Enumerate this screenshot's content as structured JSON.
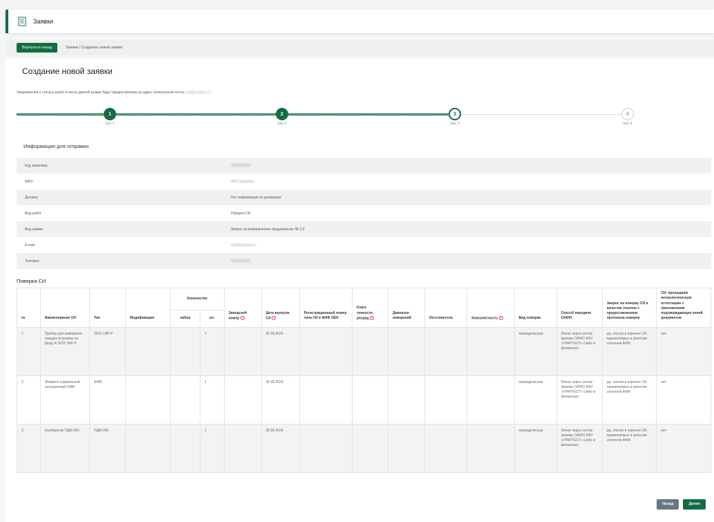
{
  "header": {
    "title": "Заявки",
    "icon": "document-icon",
    "accent": "#146c43"
  },
  "breadcrumb": {
    "back_label": "Вернуться назад",
    "path": "Заявки / Создание новой заявки"
  },
  "page": {
    "title": "Создание новой заявки",
    "notice": "Уведомления о статусе работ в части данной заявки будут предоставлены на адрес электронной почты:",
    "notice_email": "test@contoso.ru"
  },
  "stepper": {
    "steps": [
      {
        "number": "1",
        "label": "Шаг 1",
        "state": "done"
      },
      {
        "number": "2",
        "label": "Шаг 2",
        "state": "done"
      },
      {
        "number": "3",
        "label": "Шаг 3",
        "state": "current"
      },
      {
        "number": "4",
        "label": "Шаг 4",
        "state": "todo"
      }
    ]
  },
  "info": {
    "title": "Информация для отправки",
    "rows": [
      {
        "label": "Код заказчика",
        "value": "0000000000",
        "blurred": true
      },
      {
        "label": "ФИО",
        "value": "ФИО Фамилия",
        "blurred": true
      },
      {
        "label": "Договор",
        "value": "Нет информации по договорам",
        "blurred": false
      },
      {
        "label": "Вид работ",
        "value": "Поверка СИ",
        "blurred": false
      },
      {
        "label": "Вид заявки",
        "value": "Запрос на коммерческое предложение ЛК 2.0",
        "blurred": false
      },
      {
        "label": "E-mail",
        "value": "test@contoso.ru",
        "blurred": true
      },
      {
        "label": "Телефон",
        "value": "0000000000",
        "blurred": true
      }
    ]
  },
  "poverka": {
    "title": "Поверка СИ",
    "headers": {
      "num": "№",
      "name": "Наименование СИ",
      "type": "Тип",
      "mod": "Модификация",
      "qty": "Количество",
      "qty_set": "набор",
      "qty_pcs": "шт.",
      "serial": "Заводской номер",
      "date": "Дата выпуска СИ",
      "reg": "Регистрационный номер типа СИ в ФИФ ОЕИ",
      "class": "Класс точности, разряд",
      "range": "Диапазон измерений",
      "maker": "Изготовитель",
      "complete": "Комплектность",
      "kind": "Вид поверки",
      "method": "Способ передачи СИ/ИО",
      "request": "Запрос на поверку СИ в качестве эталона с предоставлением протокола поверки",
      "attest": "СИ, прошедшие метрологическую аттестацию с приложением подтверждающих копий документов"
    },
    "rows": [
      {
        "num": "1",
        "name": "Прибор для измерения твердости резины по Шору А 2033 ТИР-Р",
        "type": "2033 ТИР-Р",
        "mod": "",
        "qty_set": "",
        "qty_pcs": "1",
        "serial": "",
        "date": "30.08.2024",
        "reg": "",
        "class": "",
        "range": "",
        "maker": "",
        "complete": "",
        "kind": "периодическая",
        "method": "Лично через сектор приема СИ/ИО ФБУ «УРАЛТЕСТ» (либо в филиалах)",
        "request": "да, эталон в перечне СИ, применяемых в качестве эталонов ФИФ",
        "attest": "нет"
      },
      {
        "num": "2",
        "name": "Элемент нормальный насыщенный Х480",
        "type": "Х480",
        "mod": "",
        "qty_set": "",
        "qty_pcs": "1",
        "serial": "",
        "date": "30.08.2024",
        "reg": "",
        "class": "",
        "range": "",
        "maker": "",
        "complete": "",
        "kind": "периодическая",
        "method": "Лично через сектор приема СИ/ИО ФБУ «УРАЛТЕСТ» (либо в филиалах)",
        "request": "да, эталон в перечне СИ, применяемых в качестве эталонов ФИФ",
        "attest": "нет"
      },
      {
        "num": "3",
        "name": "Калибратор ПДМ-300",
        "type": "ПДМ-300",
        "mod": "",
        "qty_set": "",
        "qty_pcs": "1",
        "serial": "",
        "date": "30.08.2024",
        "reg": "",
        "class": "",
        "range": "",
        "maker": "",
        "complete": "",
        "kind": "периодическая",
        "method": "Лично через сектор приема СИ/ИО ФБУ «УРАЛТЕСТ» (либо в филиалах)",
        "request": "да, эталон в перечне СИ, применяемых в качестве эталонов ФИФ",
        "attest": "нет"
      }
    ]
  },
  "footer": {
    "back_label": "Назад",
    "next_label": "Далее"
  }
}
